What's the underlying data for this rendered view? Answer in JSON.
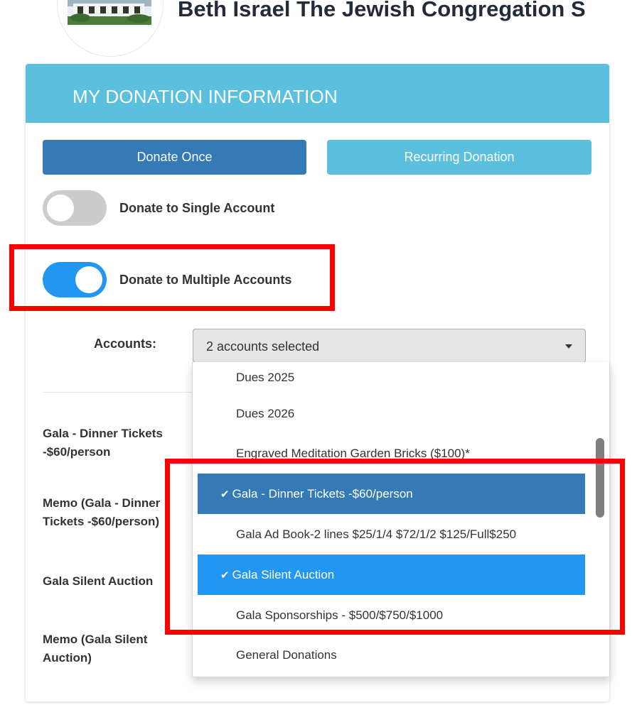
{
  "header": {
    "org_name": "Beth Israel The Jewish Congregation S"
  },
  "card": {
    "title": "MY DONATION INFORMATION",
    "donate_once_label": "Donate Once",
    "recurring_label": "Recurring Donation"
  },
  "toggles": {
    "single_label": "Donate to Single Account",
    "single_on": false,
    "multiple_label": "Donate to Multiple Accounts",
    "multiple_on": true
  },
  "accounts": {
    "label": "Accounts:",
    "selected_text": "2 accounts selected",
    "options": [
      {
        "label": "Dues 2025",
        "selected": false
      },
      {
        "label": "Dues 2026",
        "selected": false
      },
      {
        "label": "Engraved Meditation Garden Bricks ($100)*",
        "selected": false
      },
      {
        "label": "Gala - Dinner Tickets -$60/person",
        "selected": true
      },
      {
        "label": "Gala Ad Book-2 lines $25/1/4 $72/1/2 $125/Full$250",
        "selected": false
      },
      {
        "label": "Gala Silent Auction",
        "selected": true
      },
      {
        "label": "Gala Sponsorships - $500/$750/$1000",
        "selected": false
      },
      {
        "label": "General Donations",
        "selected": false
      }
    ]
  },
  "fields": {
    "gala_dinner_label": "Gala - Dinner Tickets -$60/person",
    "memo_gala_dinner_label": "Memo (Gala - Dinner Tickets -$60/person)",
    "gala_silent_label": "Gala Silent Auction",
    "memo_gala_silent_label": "Memo (Gala Silent Auction)"
  },
  "icons": {
    "check": "check-icon",
    "caret": "caret-down-icon"
  },
  "colors": {
    "header_bg": "#5bc0de",
    "primary": "#337ab7",
    "toggle_on": "#2196f3",
    "highlight": "#ff0000"
  }
}
